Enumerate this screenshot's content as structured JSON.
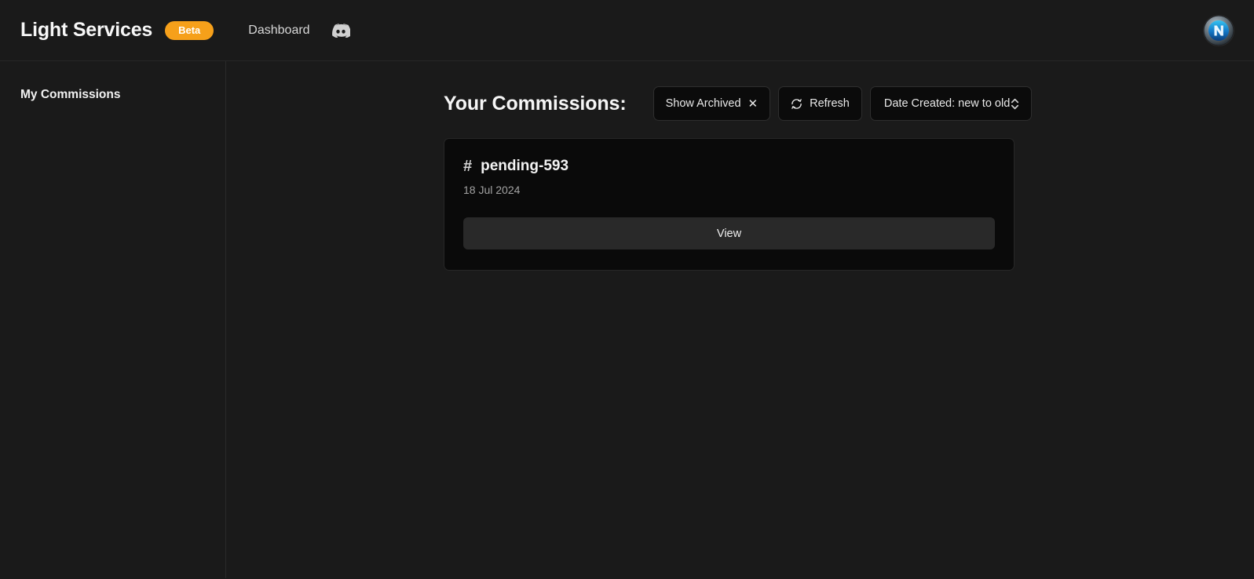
{
  "header": {
    "brand": "Light Services",
    "beta_badge": "Beta",
    "nav": [
      {
        "label": "Dashboard",
        "icon": ""
      },
      {
        "label": "",
        "icon": "discord-icon"
      }
    ],
    "avatar_alt": "user-avatar",
    "accent_color": "#f6a01a"
  },
  "sidebar": {
    "heading": "My Commissions"
  },
  "main": {
    "page_title": "Your Commissions:",
    "toolbar": {
      "show_archived_label": "Show Archived",
      "show_archived_clear_icon": "close-icon",
      "refresh_label": "Refresh",
      "refresh_icon": "refresh-icon",
      "sort_value": "Date Created: new to old",
      "sort_icon": "chevron-up-down-icon"
    },
    "commissions": [
      {
        "hash": "#",
        "name": "pending-593",
        "date": "18 Jul 2024",
        "action_label": "View"
      }
    ]
  },
  "colors": {
    "page_background": "#1a1a1a",
    "card_background": "#0a0a0a",
    "button_background": "#292929",
    "badge": "#f6a01a"
  }
}
